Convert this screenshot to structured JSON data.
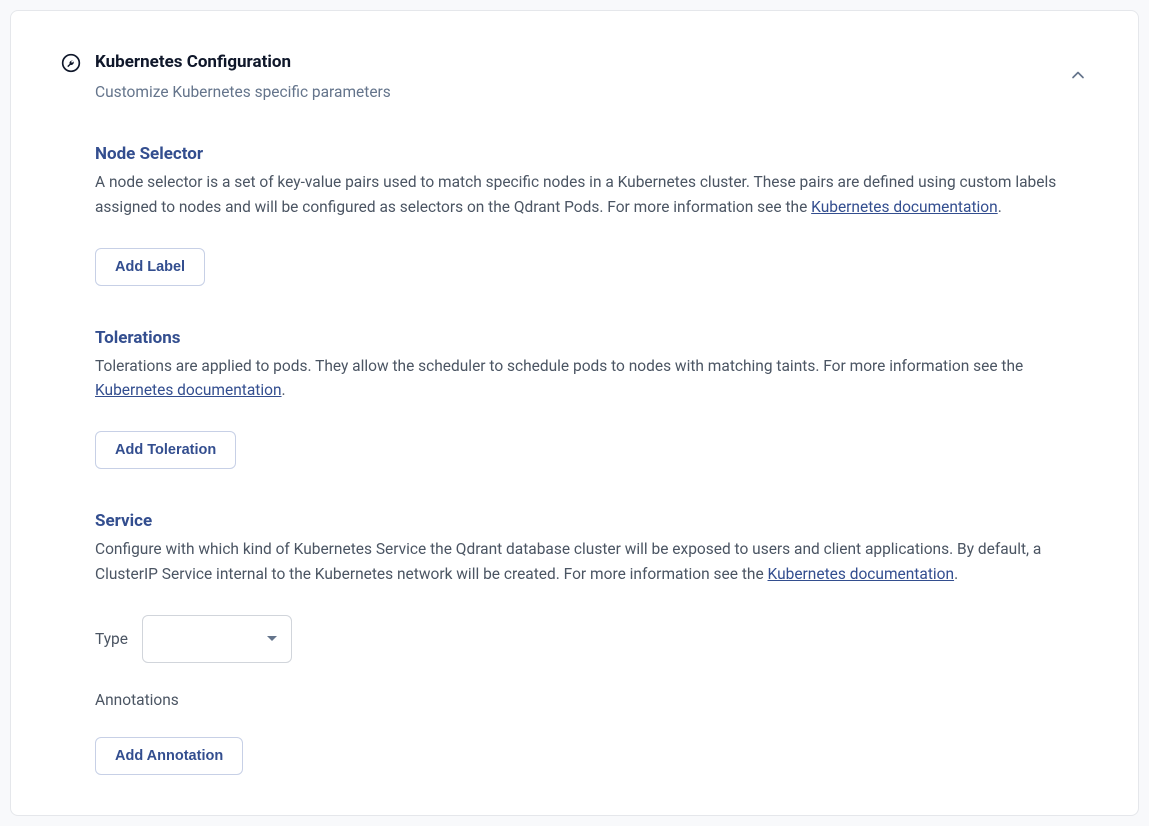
{
  "header": {
    "title": "Kubernetes Configuration",
    "subtitle": "Customize Kubernetes specific parameters"
  },
  "sections": {
    "nodeSelector": {
      "title": "Node Selector",
      "desc_part1": "A node selector is a set of key-value pairs used to match specific nodes in a Kubernetes cluster. These pairs are defined using custom labels assigned to nodes and will be configured as selectors on the Qdrant Pods. For more information see the ",
      "link": "Kubernetes documentation",
      "desc_part2": ".",
      "button": "Add Label"
    },
    "tolerations": {
      "title": "Tolerations",
      "desc_part1": "Tolerations are applied to pods. They allow the scheduler to schedule pods to nodes with matching taints. For more information see the ",
      "link": "Kubernetes documentation",
      "desc_part2": ".",
      "button": "Add Toleration"
    },
    "service": {
      "title": "Service",
      "desc_part1": "Configure with which kind of Kubernetes Service the Qdrant database cluster will be exposed to users and client applications. By default, a ClusterIP Service internal to the Kubernetes network will be created. For more information see the ",
      "link": "Kubernetes documentation",
      "desc_part2": ".",
      "type_label": "Type",
      "type_value": "",
      "annotations_label": "Annotations",
      "button": "Add Annotation"
    }
  }
}
